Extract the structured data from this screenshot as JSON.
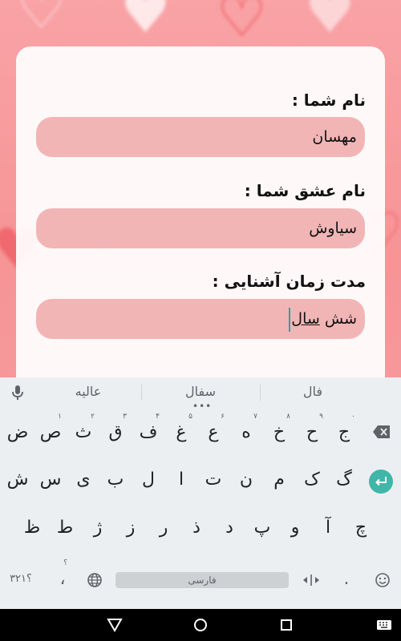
{
  "form": {
    "your_name_label": "نام شما :",
    "your_name_value": "مهسان",
    "love_name_label": "نام عشق شما :",
    "love_name_value": "سیاوش",
    "duration_label": "مدت زمان آشنایی :",
    "duration_value_prefix": "شش ",
    "duration_value_composing": "سال"
  },
  "keyboard": {
    "suggestions": [
      "فال",
      "سفال",
      "عالیه"
    ],
    "row1": [
      {
        "key": "ج",
        "hint": "۰"
      },
      {
        "key": "ح",
        "hint": "۹"
      },
      {
        "key": "خ",
        "hint": "۸"
      },
      {
        "key": "ه",
        "hint": "۷"
      },
      {
        "key": "ع",
        "hint": "۶"
      },
      {
        "key": "غ",
        "hint": "۵"
      },
      {
        "key": "ف",
        "hint": "۴"
      },
      {
        "key": "ق",
        "hint": "۳"
      },
      {
        "key": "ث",
        "hint": "۲"
      },
      {
        "key": "ص",
        "hint": "۱"
      },
      {
        "key": "ض",
        "hint": ""
      }
    ],
    "row2": [
      "گ",
      "ک",
      "م",
      "ن",
      "ت",
      "ا",
      "ل",
      "ب",
      "ی",
      "س",
      "ش"
    ],
    "row3": [
      "چ",
      "آ",
      "و",
      "پ",
      "د",
      "ذ",
      "ر",
      "ز",
      "ژ",
      "ط",
      "ظ"
    ],
    "symbols_key": "؟۳۲۱",
    "comma_key": "،",
    "comma_hint": "؟",
    "period_key": ".",
    "space_label": "فارسی"
  },
  "colors": {
    "background": "#f69496",
    "input_fill": "#f2b5b6",
    "accent": "#3fb6a8"
  }
}
